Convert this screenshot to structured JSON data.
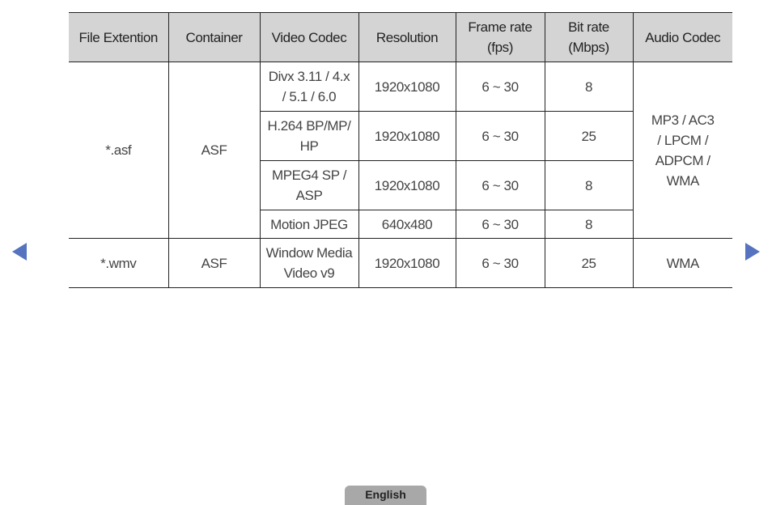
{
  "table": {
    "headers": [
      "File Extention",
      "Container",
      "Video Codec",
      "Resolution",
      "Frame rate (fps)",
      "Bit rate (Mbps)",
      "Audio Codec"
    ],
    "header_lines": {
      "frame_rate": [
        "Frame rate",
        "(fps)"
      ],
      "bit_rate": [
        "Bit rate",
        "(Mbps)"
      ]
    },
    "groups": [
      {
        "extension": "*.asf",
        "container": "ASF",
        "audio_codec": "MP3 / AC3 / LPCM / ADPCM / WMA",
        "audio_codec_lines": [
          "MP3 / AC3",
          "/ LPCM /",
          "ADPCM /",
          "WMA"
        ],
        "rows": [
          {
            "video_codec": "Divx 3.11 / 4.x / 5.1 / 6.0",
            "video_codec_lines": [
              "Divx 3.11 / 4.x",
              "/ 5.1 / 6.0"
            ],
            "resolution": "1920x1080",
            "frame_rate": "6 ~ 30",
            "bit_rate": "8"
          },
          {
            "video_codec": "H.264 BP/MP/HP",
            "video_codec_lines": [
              "H.264 BP/MP/",
              "HP"
            ],
            "resolution": "1920x1080",
            "frame_rate": "6 ~ 30",
            "bit_rate": "25"
          },
          {
            "video_codec": "MPEG4 SP / ASP",
            "video_codec_lines": [
              "MPEG4 SP /",
              "ASP"
            ],
            "resolution": "1920x1080",
            "frame_rate": "6 ~ 30",
            "bit_rate": "8"
          },
          {
            "video_codec": "Motion JPEG",
            "video_codec_lines": [
              "Motion JPEG"
            ],
            "resolution": "640x480",
            "frame_rate": "6 ~ 30",
            "bit_rate": "8"
          }
        ]
      },
      {
        "extension": "*.wmv",
        "container": "ASF",
        "audio_codec": "WMA",
        "audio_codec_lines": [
          "WMA"
        ],
        "rows": [
          {
            "video_codec": "Window Media Video v9",
            "video_codec_lines": [
              "Window Media",
              "Video v9"
            ],
            "resolution": "1920x1080",
            "frame_rate": "6 ~ 30",
            "bit_rate": "25"
          }
        ]
      }
    ]
  },
  "navigation": {
    "prev_icon": "triangle-left",
    "next_icon": "triangle-right",
    "arrow_color": "#5573be"
  },
  "footer": {
    "language_label": "English"
  }
}
